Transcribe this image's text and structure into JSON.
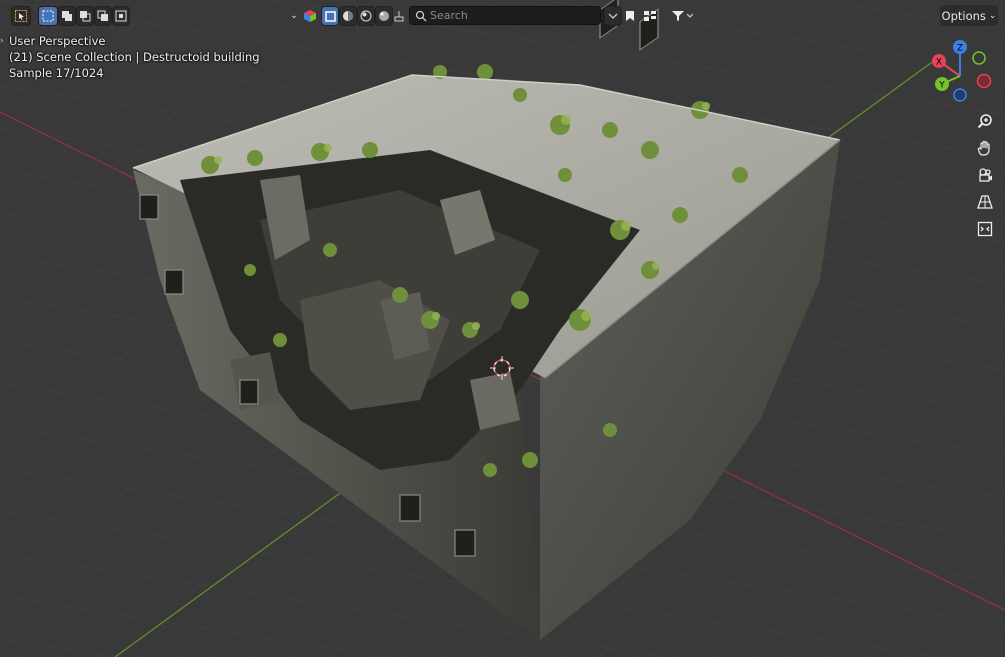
{
  "header": {
    "search_placeholder": "Search",
    "options_label": "Options"
  },
  "overlay": {
    "view_name": "User Perspective",
    "collection_line": "(21) Scene Collection | Destructoid building",
    "sample_line": "Sample 17/1024"
  },
  "gizmo": {
    "x_label": "X",
    "y_label": "Y",
    "z_label": "Z",
    "x_color": "#e34456",
    "y_color": "#75c22c",
    "z_color": "#3b82e6"
  },
  "colors": {
    "viewport_bg": "#3a3a3a",
    "grid_line": "#454545",
    "x_axis": "#9a3a45",
    "y_axis": "#6a9a34",
    "accent": "#4772b3"
  },
  "icons": {
    "select_tool": "cursor-select-icon",
    "viewport_shading": [
      "solid-shading-icon",
      "material-shading-icon",
      "rendered-shading-icon"
    ],
    "filter": "filter-icon"
  }
}
